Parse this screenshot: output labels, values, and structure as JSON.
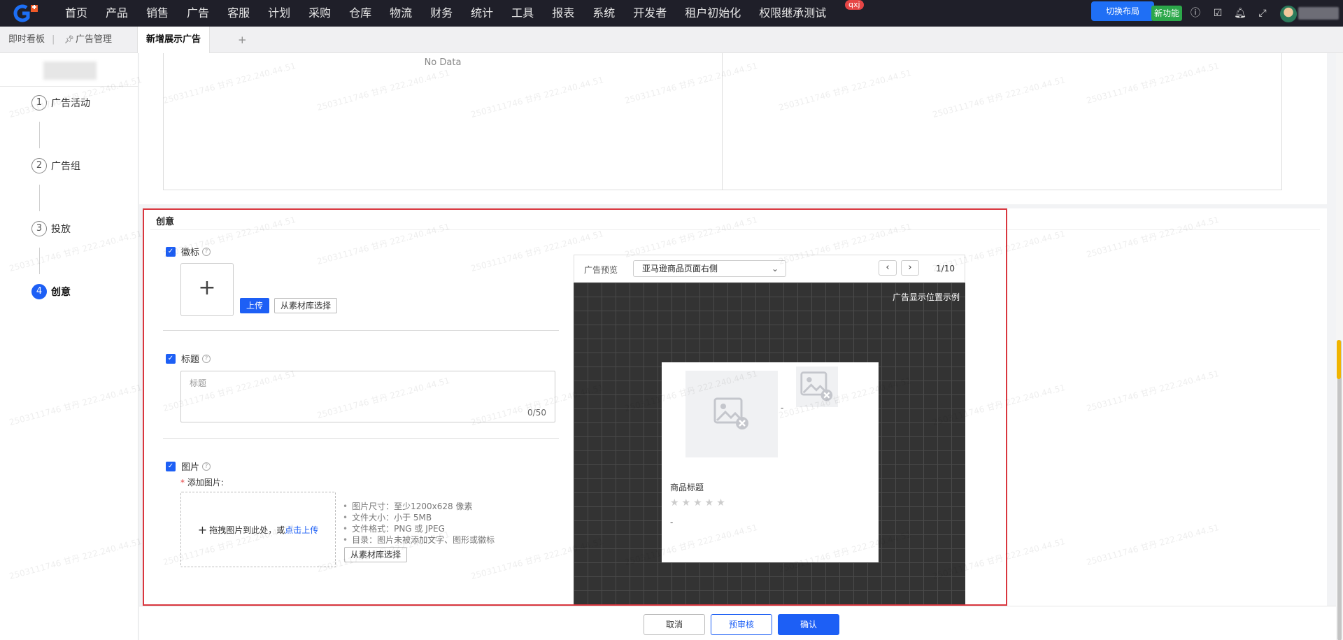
{
  "nav": {
    "items": [
      "首页",
      "产品",
      "销售",
      "广告",
      "客服",
      "计划",
      "采购",
      "仓库",
      "物流",
      "财务",
      "统计",
      "工具",
      "报表",
      "系统",
      "开发者",
      "租户初始化",
      "权限继承测试"
    ],
    "badge": "qxj",
    "switch_layout_label": "切换布局",
    "new_feature_label": "新功能"
  },
  "tabs": {
    "dashboard": "即时看板",
    "ad_manage": "广告管理",
    "current": "新增展示广告",
    "add": "+"
  },
  "steps": [
    {
      "num": "1",
      "label": "广告活动"
    },
    {
      "num": "2",
      "label": "广告组"
    },
    {
      "num": "3",
      "label": "投放"
    },
    {
      "num": "4",
      "label": "创意"
    }
  ],
  "upper": {
    "no_data": "No Data"
  },
  "creative": {
    "title": "创意",
    "logo": {
      "label": "徽标",
      "upload_label": "上传",
      "library_label": "从素材库选择"
    },
    "headline": {
      "label": "标题",
      "placeholder": "标题",
      "count": "0/50"
    },
    "image": {
      "label": "图片",
      "add_label": "添加图片:",
      "drop_text": "拖拽图片到此处，或",
      "drop_link": "点击上传",
      "specs": [
        "图片尺寸：至少1200x628 像素",
        "文件大小：小于 5MB",
        "文件格式：PNG 或 JPEG",
        "目录：图片未被添加文字、图形或徽标"
      ],
      "library_label": "从素材库选择"
    }
  },
  "preview": {
    "label": "广告预览",
    "placement": "亚马逊商品页面右侧",
    "page": "1/10",
    "caption": "广告显示位置示例",
    "product_title": "商品标题",
    "dash1": "-",
    "dash2": "-",
    "rating_stars": 0
  },
  "footer": {
    "cancel": "取消",
    "pre_review": "预审核",
    "confirm": "确认"
  },
  "watermark": "2503111746 甘丹 222.240.44.51",
  "colors": {
    "primary": "#1d5ff5",
    "highlight_border": "#d9363e",
    "new_badge": "#2ca84a"
  }
}
